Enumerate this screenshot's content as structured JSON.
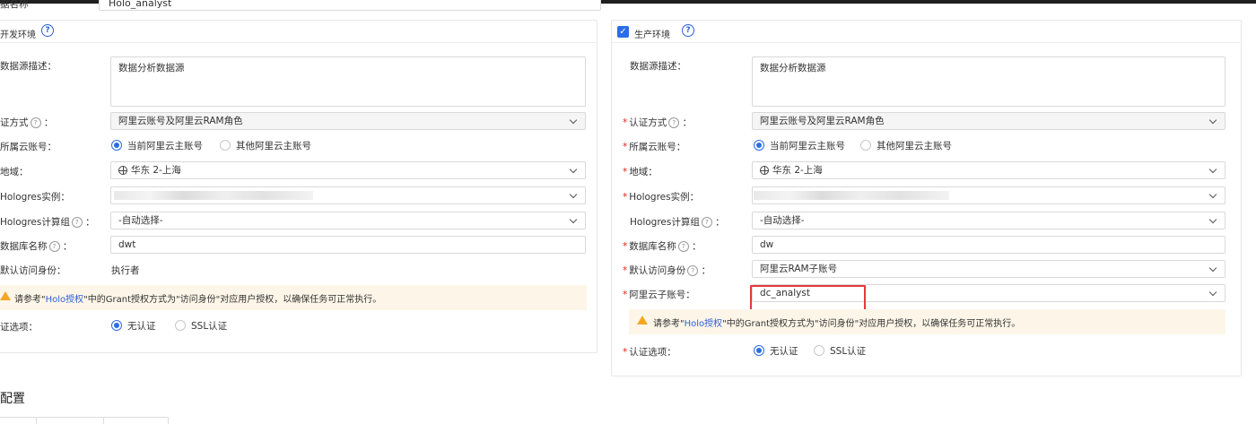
{
  "top": {
    "name_value": "Holo_analyst",
    "name_label_fragment": "据名称"
  },
  "dev": {
    "title": "开发环境",
    "help_icon": "question-circle-icon",
    "desc_label": "数据源描述：",
    "desc_value": "数据分析数据源",
    "auth_label": "证方式",
    "auth_value": "阿里云账号及阿里云RAM角色",
    "account_label": "所属云账号：",
    "account_opt1": "当前阿里云主账号",
    "account_opt2": "其他阿里云主账号",
    "region_label": "地域：",
    "region_value": "华东 2-上海",
    "instance_label": "Hologres实例：",
    "compute_label": "Hologres计算组",
    "compute_value": "-自动选择-",
    "db_label": "数据库名称",
    "db_value": "dwt",
    "identity_label": "默认访问身份：",
    "identity_value": "执行者",
    "warn_pre": "请参考\"",
    "warn_link": "Holo授权",
    "warn_post": "\"中的Grant授权方式为\"访问身份\"对应用户授权，以确保任务可正常执行。",
    "verify_label": "证选项：",
    "verify_opt1": "无认证",
    "verify_opt2": "SSL认证"
  },
  "prod": {
    "title": "生产环境",
    "checked": true,
    "help_icon": "question-circle-icon",
    "desc_label": "数据源描述：",
    "desc_value": "数据分析数据源",
    "auth_label": "认证方式",
    "auth_value": "阿里云账号及阿里云RAM角色",
    "account_label": "所属云账号：",
    "account_opt1": "当前阿里云主账号",
    "account_opt2": "其他阿里云主账号",
    "region_label": "地域：",
    "region_value": "华东 2-上海",
    "instance_label": "Hologres实例：",
    "compute_label": "Hologres计算组",
    "compute_value": "-自动选择-",
    "db_label": "数据库名称",
    "db_value": "dw",
    "identity_label": "默认访问身份",
    "identity_value": "阿里云RAM子账号",
    "subaccount_label": "阿里云子账号：",
    "subaccount_value": "dc_analyst",
    "warn_pre": "请参考\"",
    "warn_link": "Holo授权",
    "warn_post": "\"中的Grant授权方式为\"访问身份\"对应用户授权，以确保任务可正常执行。",
    "verify_label": "认证选项：",
    "verify_opt1": "无认证",
    "verify_opt2": "SSL认证"
  },
  "bottom": {
    "heading": "配置"
  },
  "colors": {
    "accent": "#2b6de5",
    "required": "#e0241b",
    "highlight_box": "#e4393c",
    "warning_bg": "#fdf6e8",
    "warning_icon": "#f5a623"
  }
}
